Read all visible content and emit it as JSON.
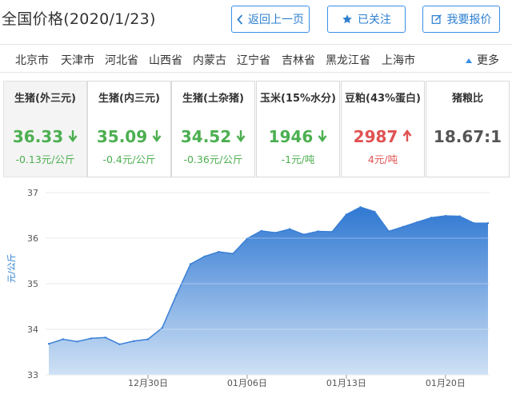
{
  "title": "全国价格(2020/1/23)",
  "header_buttons": {
    "back_label": "返回上一页",
    "follow_label": "已关注",
    "report_label": "我要报价"
  },
  "regions": [
    "北京市",
    "天津市",
    "河北省",
    "山西省",
    "内蒙古",
    "辽宁省",
    "吉林省",
    "黑龙江省",
    "上海市"
  ],
  "more_label": "更多",
  "cards": [
    {
      "name": "生猪(外三元)",
      "value": "36.33",
      "change": "-0.13元/公斤",
      "trend": "down"
    },
    {
      "name": "生猪(内三元)",
      "value": "35.09",
      "change": "-0.4元/公斤",
      "trend": "down"
    },
    {
      "name": "生猪(土杂猪)",
      "value": "34.52",
      "change": "-0.36元/公斤",
      "trend": "down"
    },
    {
      "name": "玉米(15%水分)",
      "value": "1946",
      "change": "-1元/吨",
      "trend": "down"
    },
    {
      "name": "豆粕(43%蛋白)",
      "value": "2987",
      "change": "4元/吨",
      "trend": "up"
    },
    {
      "name": "猪粮比",
      "value": "18.67:1",
      "change": "",
      "trend": "none"
    }
  ],
  "colors": {
    "accent": "#2d7fd0",
    "down": "#4caf50",
    "up": "#e05252"
  },
  "chart_data": {
    "type": "area",
    "ylabel": "元/公斤",
    "ylim": [
      33,
      37
    ],
    "yticks": [
      33,
      34,
      35,
      36,
      37
    ],
    "xtick_labels": [
      "12月30日",
      "01月06日",
      "01月13日",
      "01月20日"
    ],
    "xtick_index": [
      7,
      14,
      21,
      28
    ],
    "x": [
      "12月23日",
      "12月24日",
      "12月25日",
      "12月26日",
      "12月27日",
      "12月28日",
      "12月29日",
      "12月30日",
      "12月31日",
      "01月01日",
      "01月02日",
      "01月03日",
      "01月04日",
      "01月05日",
      "01月06日",
      "01月07日",
      "01月08日",
      "01月09日",
      "01月10日",
      "01月11日",
      "01月12日",
      "01月13日",
      "01月14日",
      "01月15日",
      "01月16日",
      "01月17日",
      "01月18日",
      "01月19日",
      "01月20日",
      "01月21日",
      "01月22日",
      "01月23日"
    ],
    "values": [
      33.68,
      33.78,
      33.73,
      33.8,
      33.82,
      33.67,
      33.74,
      33.78,
      34.03,
      34.75,
      35.43,
      35.6,
      35.7,
      35.66,
      35.99,
      36.16,
      36.12,
      36.2,
      36.08,
      36.15,
      36.14,
      36.52,
      36.68,
      36.58,
      36.15,
      36.25,
      36.35,
      36.45,
      36.49,
      36.48,
      36.33,
      36.33
    ],
    "grid": true,
    "color": "#3a7fd5"
  }
}
